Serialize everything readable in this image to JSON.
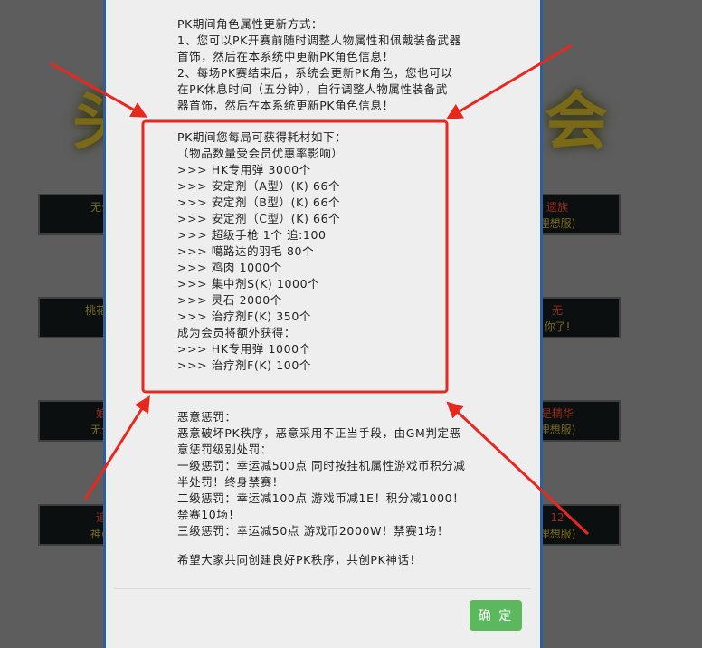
{
  "background": {
    "title_left": "头",
    "title_right": "会",
    "tiles_left": [
      {
        "line1": "",
        "line2": "无公"
      },
      {
        "line1": "",
        "line2": "桃花岛"
      },
      {
        "line1": "娘",
        "line2": "无公"
      },
      {
        "line1": "追",
        "line2": "神の"
      }
    ],
    "tiles_right": [
      {
        "line1": "遗族",
        "line2": "理想服)"
      },
      {
        "line1": "无",
        "line2": "你了!"
      },
      {
        "line1": "是精华",
        "line2": "理想服)"
      },
      {
        "line1": "12",
        "line2": "理想服)"
      }
    ]
  },
  "modal": {
    "section_update": [
      "PK期间角色属性更新方式：",
      "1、您可以PK开赛前随时调整人物属性和佩戴装备武器",
      "首饰，然后在本系统中更新PK角色信息！",
      "2、每场PK赛结束后，系统会更新PK角色，您也可以",
      "在PK休息时间（五分钟），自行调整人物属性装备武",
      "器首饰，然后在本系统更新PK角色信息！"
    ],
    "section_rewards": [
      "PK期间您每局可获得耗材如下：",
      "（物品数量受会员优惠率影响）",
      ">>> HK专用弹 3000个",
      ">>> 安定剂（A型）(K) 66个",
      ">>> 安定剂（B型）(K) 66个",
      ">>> 安定剂（C型）(K) 66个",
      ">>> 超级手枪 1个 追:100",
      ">>> 噶路达的羽毛 80个",
      ">>> 鸡肉 1000个",
      ">>> 集中剂S(K) 1000个",
      ">>> 灵石 2000个",
      ">>> 治疗剂F(K) 350个",
      "成为会员将额外获得：",
      ">>> HK专用弹 1000个",
      ">>> 治疗剂F(K) 100个"
    ],
    "section_penalty": [
      "恶意惩罚：",
      "恶意破坏PK秩序，恶意采用不正当手段，由GM判定恶",
      "意惩罚级别处罚：",
      "一级惩罚：幸运减500点 同时按挂机属性游戏币积分减",
      "半处罚！终身禁赛！",
      "二级惩罚：幸运减100点 游戏币减1E！积分减1000！",
      "禁赛10场！",
      "三级惩罚：幸运减50点 游戏币2000W！禁赛1场！"
    ],
    "closing": "希望大家共同创建良好PK秩序，共创PK神话！",
    "ok_label": "确 定"
  },
  "colors": {
    "annotation_red": "#e8281e",
    "ok_green": "#5cb85c",
    "modal_border": "#2a5fa0"
  }
}
